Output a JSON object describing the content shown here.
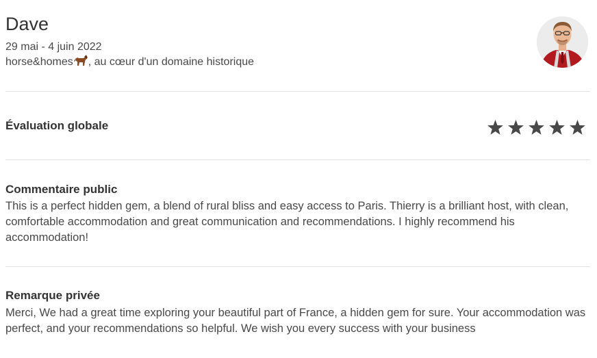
{
  "guest": {
    "name": "Dave",
    "dates": "29 mai - 4 juin 2022",
    "listing_prefix": "horse&homes",
    "listing_suffix": ", au cœur d'un domaine historique",
    "listing_emoji": "horse-emoji",
    "avatar": "profile-photo"
  },
  "rating": {
    "label": "Évaluation globale",
    "stars": 5,
    "max_stars": 5,
    "star_color": "#484848"
  },
  "public_comment": {
    "title": "Commentaire public",
    "text": "This is a perfect hidden gem, a blend of rural bliss and easy access to Paris. Thierry is a brilliant host, with clean, comfortable accommodation and great communication and recommendations. I highly recommend his accommodation!"
  },
  "private_note": {
    "title": "Remarque privée",
    "text": "Merci, We had a great time exploring your beautiful part of France, a hidden gem for sure. Your accommodation was perfect, and your recommendations so helpful. We wish you every success with your business"
  },
  "colors": {
    "text_primary": "#333333",
    "text_secondary": "#484848",
    "divider": "#e2e2e2"
  }
}
